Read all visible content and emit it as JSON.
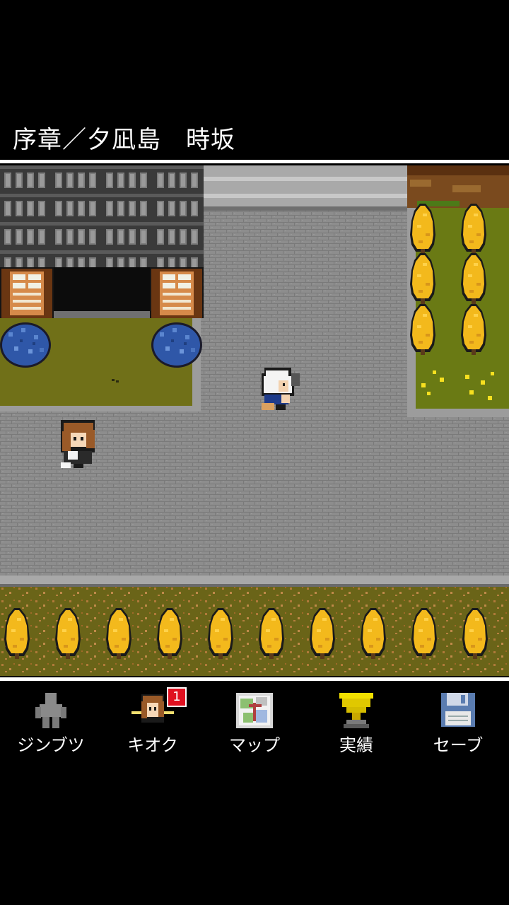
{
  "header": {
    "location": "序章／夕凪島　時坂"
  },
  "menu": {
    "items": [
      {
        "id": "jinbutsu",
        "label": "ジンブツ",
        "icon": "person-silhouette-icon"
      },
      {
        "id": "kioku",
        "label": "キオク",
        "icon": "girl-portrait-icon",
        "badge": "1"
      },
      {
        "id": "map",
        "label": "マップ",
        "icon": "map-icon"
      },
      {
        "id": "jisseki",
        "label": "実績",
        "icon": "trophy-icon"
      },
      {
        "id": "save",
        "label": "セーブ",
        "icon": "floppy-disk-icon"
      }
    ]
  },
  "colors": {
    "background": "#000000",
    "text": "#ffffff",
    "badge": "#e01020",
    "stone_path": "#8a8a8a",
    "ginkgo": "#f0b81a",
    "hydrangea": "#3a63b8",
    "grass": "#6b6a1a"
  }
}
